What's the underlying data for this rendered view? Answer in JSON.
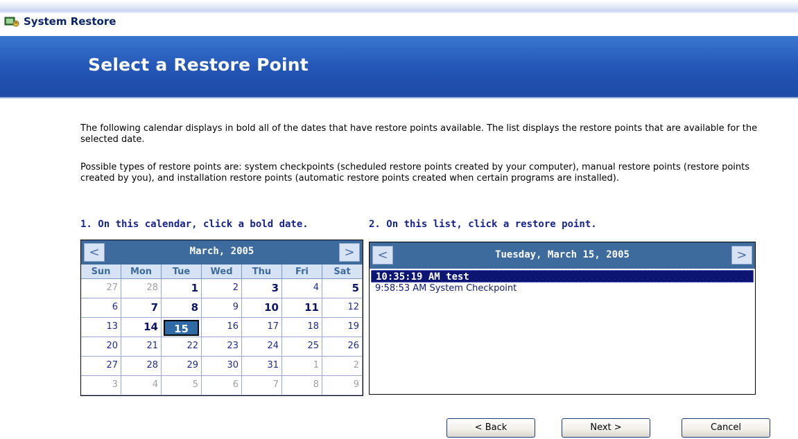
{
  "window": {
    "title": "System Restore",
    "icon": "system-restore-icon"
  },
  "header": {
    "title": "Select a Restore Point"
  },
  "intro": {
    "paragraph1": "The following calendar displays in bold all of the dates that have restore points available. The list displays the restore points that are available for the selected date.",
    "paragraph2": "Possible types of restore points are: system checkpoints (scheduled restore points created by your computer), manual restore points (restore points created by you), and installation restore points (automatic restore points created when certain programs are installed)."
  },
  "steps": {
    "calendar_instruction": "1. On this calendar, click a bold date.",
    "list_instruction": "2. On this list, click a restore point."
  },
  "calendar": {
    "month_label": "March, 2005",
    "prev": "<",
    "next": ">",
    "weekdays": [
      "Sun",
      "Mon",
      "Tue",
      "Wed",
      "Thu",
      "Fri",
      "Sat"
    ],
    "selected_day": "15",
    "bold_days": [
      "1",
      "3",
      "5",
      "7",
      "8",
      "10",
      "11",
      "14",
      "15"
    ],
    "weeks": [
      [
        {
          "d": "27",
          "other": true
        },
        {
          "d": "28",
          "other": true
        },
        {
          "d": "1"
        },
        {
          "d": "2"
        },
        {
          "d": "3"
        },
        {
          "d": "4"
        },
        {
          "d": "5"
        }
      ],
      [
        {
          "d": "6"
        },
        {
          "d": "7"
        },
        {
          "d": "8"
        },
        {
          "d": "9"
        },
        {
          "d": "10"
        },
        {
          "d": "11"
        },
        {
          "d": "12"
        }
      ],
      [
        {
          "d": "13"
        },
        {
          "d": "14"
        },
        {
          "d": "15"
        },
        {
          "d": "16"
        },
        {
          "d": "17"
        },
        {
          "d": "18"
        },
        {
          "d": "19"
        }
      ],
      [
        {
          "d": "20"
        },
        {
          "d": "21"
        },
        {
          "d": "22"
        },
        {
          "d": "23"
        },
        {
          "d": "24"
        },
        {
          "d": "25"
        },
        {
          "d": "26"
        }
      ],
      [
        {
          "d": "27"
        },
        {
          "d": "28"
        },
        {
          "d": "29"
        },
        {
          "d": "30"
        },
        {
          "d": "31"
        },
        {
          "d": "1",
          "other": true
        },
        {
          "d": "2",
          "other": true
        }
      ],
      [
        {
          "d": "3",
          "other": true
        },
        {
          "d": "4",
          "other": true
        },
        {
          "d": "5",
          "other": true
        },
        {
          "d": "6",
          "other": true
        },
        {
          "d": "7",
          "other": true
        },
        {
          "d": "8",
          "other": true
        },
        {
          "d": "9",
          "other": true
        }
      ]
    ]
  },
  "restore_list": {
    "date_label": "Tuesday, March 15, 2005",
    "prev": "<",
    "next": ">",
    "items": [
      {
        "label": "10:35:19 AM  test",
        "selected": true
      },
      {
        "label": "9:58:53 AM  System Checkpoint",
        "selected": false
      }
    ]
  },
  "buttons": {
    "back": "< Back",
    "next": "Next >",
    "cancel": "Cancel"
  },
  "colors": {
    "header_blue": "#2457b8",
    "calendar_head": "#3d6b9e",
    "selection": "#0c1672",
    "instruction_text": "#15228f"
  }
}
